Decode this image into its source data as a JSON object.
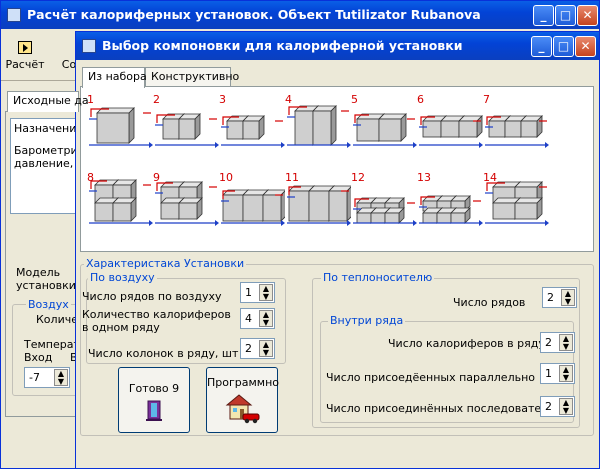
{
  "main_window": {
    "title": "Расчёт калориферных установок. Объект Tutilizator Rubanova",
    "toolbar": {
      "calc_label": "Расчёт",
      "second_label": "Со"
    },
    "tab_label": "Исходные да",
    "labels": {
      "purpose": "Назначение",
      "barometric_1": "Барометри",
      "barometric_2": "давление,",
      "model_1": "Модель",
      "model_2": "установки",
      "air": "Воздух",
      "quantity": "Количес",
      "temperature": "Температ",
      "inlet": "Вход",
      "inlet_suffix": "В"
    },
    "inlet_value": "-7"
  },
  "dialog": {
    "title": "Выбор компоновки для калориферной установки",
    "tabs": [
      "Из набора",
      "Конструктивно"
    ],
    "layouts": [
      "1",
      "2",
      "3",
      "4",
      "5",
      "6",
      "7",
      "8",
      "9",
      "10",
      "11",
      "12",
      "13",
      "14"
    ],
    "characteristics": {
      "title": "Характеристака Установки",
      "by_air": {
        "title": "По воздуху",
        "rows_label": "Число рядов по воздуху",
        "rows_value": "1",
        "heaters_label_1": "Количество калориферов",
        "heaters_label_2": "в одном ряду",
        "heaters_value": "4",
        "columns_label": "Число колонок в ряду, шт",
        "columns_value": "2"
      },
      "by_coolant": {
        "title": "По теплоносителю",
        "rows_label": "Число рядов",
        "rows_value": "2",
        "inside_row": {
          "title": "Внутри ряда",
          "heaters_label": "Число калориферов в ряду",
          "heaters_value": "2",
          "parallel_label": "Число присоедёенных параллельно",
          "parallel_value": "1",
          "serial_label": "Число присоединённых последовательно",
          "serial_value": "2"
        }
      }
    },
    "buttons": {
      "ready": "Готово 9",
      "programmatic": "Программно"
    }
  },
  "colors": {
    "title_blue": "#0a4fd6",
    "group_blue": "#0046d5",
    "layout_red": "#d40000",
    "layout_blue": "#1c3fc7"
  }
}
